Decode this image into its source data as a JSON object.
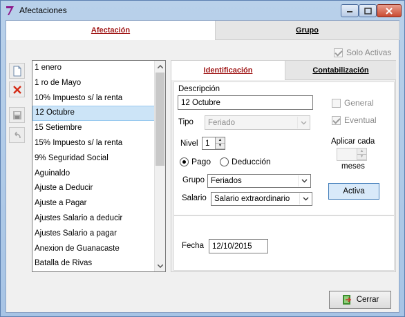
{
  "window": {
    "title": "Afectaciones"
  },
  "top_tabs": [
    {
      "label": "Afectación"
    },
    {
      "label": "Grupo"
    }
  ],
  "solo_activas": {
    "label": "Solo Activas",
    "checked": true
  },
  "toolbar": {
    "icons": [
      "new-document-icon",
      "delete-icon",
      "save-icon",
      "undo-icon"
    ]
  },
  "list": {
    "items": [
      "1 enero",
      "1 ro de Mayo",
      "10% Impuesto s/ la renta",
      "12 Octubre",
      "15 Setiembre",
      "15% Impuesto s/ la renta",
      "9% Seguridad Social",
      "Aguinaldo",
      "Ajuste a Deducir",
      "Ajuste a Pagar",
      "Ajustes Salario a deducir",
      "Ajustes Salario a pagar",
      "Anexion de Guanacaste",
      "Batalla de Rivas"
    ],
    "selected": "12 Octubre"
  },
  "sub_tabs": [
    {
      "label": "Identificación"
    },
    {
      "label": "Contabilización"
    }
  ],
  "form": {
    "descripcion_label": "Descripción",
    "descripcion_value": "12 Octubre",
    "tipo_label": "Tipo",
    "tipo_value": "Feriado",
    "nivel_label": "Nivel",
    "nivel_value": "1",
    "pago_label": "Pago",
    "deduccion_label": "Deducción",
    "grupo_label": "Grupo",
    "grupo_value": "Feriados",
    "salario_label": "Salario",
    "salario_value": "Salario extraordinario",
    "general_label": "General",
    "eventual_label": "Eventual",
    "aplicar_label": "Aplicar cada",
    "meses_label": "meses",
    "activa_label": "Activa",
    "fecha_label": "Fecha",
    "fecha_value": "12/10/2015"
  },
  "footer": {
    "cerrar_label": "Cerrar"
  },
  "colors": {
    "accent": "#a01818",
    "selection": "#cce4f7",
    "activa_button": "#d8e9f9"
  }
}
